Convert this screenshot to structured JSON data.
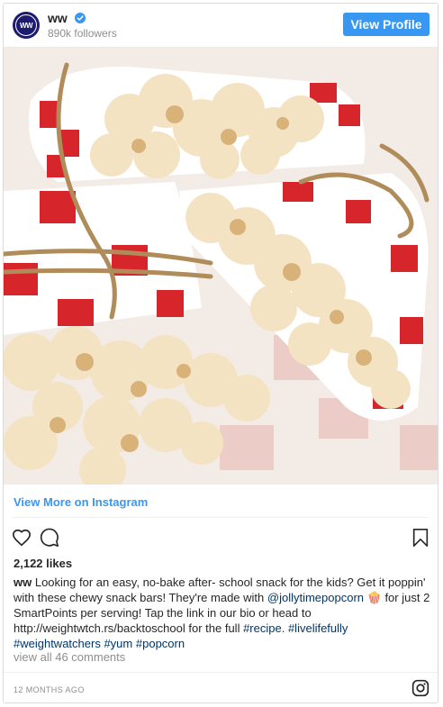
{
  "header": {
    "avatar_text": "WW",
    "username": "ww",
    "verified": true,
    "followers": "890k followers",
    "view_profile_label": "View Profile"
  },
  "post": {
    "photo_description_icon": "popcorn-snack-bars-photo",
    "view_more_label": "View More on Instagram",
    "likes": "2,122 likes",
    "caption": {
      "username": "ww",
      "text_1": " Looking for an easy, no-bake after- school snack for the kids? Get it poppin' with these chewy snack bars! They're made with ",
      "mention": "@jollytimepopcorn",
      "emoji": "🍿",
      "text_2": " for just 2 SmartPoints per serving! Tap the link in our bio or head to http://weightwtch.rs/backtoschool for the full ",
      "hashtag_1": "#recipe",
      "text_3": ". ",
      "hashtag_2": "#livelifefully",
      "hashtag_3": "#weightwatchers",
      "hashtag_4": "#yum",
      "hashtag_5": "#popcorn"
    },
    "comments_label": "view all 46 comments",
    "timestamp": "12 MONTHS AGO"
  },
  "colors": {
    "accent": "#3897f0",
    "hashtag": "#003569",
    "brand_avatar": "#1d1b6f"
  },
  "icons": [
    "heart-icon",
    "comment-icon",
    "bookmark-icon",
    "instagram-icon",
    "verified-badge-icon"
  ]
}
